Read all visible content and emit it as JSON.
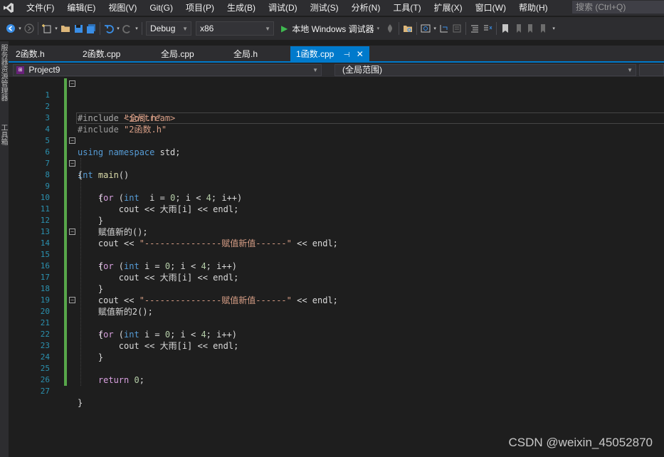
{
  "menubar": {
    "items": [
      "文件(F)",
      "编辑(E)",
      "视图(V)",
      "Git(G)",
      "项目(P)",
      "生成(B)",
      "调试(D)",
      "测试(S)",
      "分析(N)",
      "工具(T)",
      "扩展(X)",
      "窗口(W)",
      "帮助(H)"
    ],
    "search_placeholder": "搜索 (Ctrl+Q)"
  },
  "toolbar": {
    "config": "Debug",
    "platform": "x86",
    "run_label": "本地 Windows 调试器"
  },
  "left_rail": {
    "panel1": "服务器资源管理器",
    "panel2": "工具箱"
  },
  "tabs": [
    {
      "label": "2函数.h",
      "active": false
    },
    {
      "label": "2函数.cpp",
      "active": false
    },
    {
      "label": "全局.cpp",
      "active": false
    },
    {
      "label": "全局.h",
      "active": false
    },
    {
      "label": "1函数.cpp",
      "active": true
    }
  ],
  "navbar": {
    "project": "Project9",
    "scope": "(全局范围)"
  },
  "code_lines": [
    {
      "n": "1",
      "text": "#include <iostream>"
    },
    {
      "n": "2",
      "text": "#include \"全局.h\""
    },
    {
      "n": "3",
      "text": "#include \"2函数.h\""
    },
    {
      "n": "4",
      "text": ""
    },
    {
      "n": "5",
      "text": "using namespace std;"
    },
    {
      "n": "6",
      "text": "int main()"
    },
    {
      "n": "7",
      "text": "{"
    },
    {
      "n": "8",
      "text": "    for (int  i = 0; i < 4; i++)"
    },
    {
      "n": "9",
      "text": "    {"
    },
    {
      "n": "10",
      "text": "        cout << 大雨[i] << endl;"
    },
    {
      "n": "11",
      "text": "    }"
    },
    {
      "n": "12",
      "text": "    赋值新的();"
    },
    {
      "n": "13",
      "text": "    cout << \"---------------赋值新值------\" << endl;"
    },
    {
      "n": "14",
      "text": "    for (int i = 0; i < 4; i++)"
    },
    {
      "n": "15",
      "text": "    {"
    },
    {
      "n": "16",
      "text": "        cout << 大雨[i] << endl;"
    },
    {
      "n": "17",
      "text": "    }"
    },
    {
      "n": "18",
      "text": "    cout << \"---------------赋值新值------\" << endl;"
    },
    {
      "n": "19",
      "text": "    赋值新的2();"
    },
    {
      "n": "20",
      "text": "    for (int i = 0; i < 4; i++)"
    },
    {
      "n": "21",
      "text": "    {"
    },
    {
      "n": "22",
      "text": "        cout << 大雨[i] << endl;"
    },
    {
      "n": "23",
      "text": "    }"
    },
    {
      "n": "24",
      "text": ""
    },
    {
      "n": "25",
      "text": "    return 0;"
    },
    {
      "n": "26",
      "text": ""
    },
    {
      "n": "27",
      "text": "}"
    }
  ],
  "watermark": "CSDN @weixin_45052870",
  "colors": {
    "accent": "#007acc",
    "background": "#1e1e1e",
    "chrome": "#2d2d30",
    "change_bar": "#57a64a"
  }
}
